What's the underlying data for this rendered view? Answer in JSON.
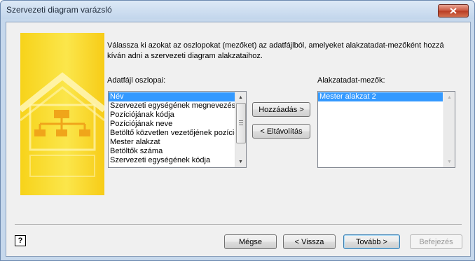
{
  "window": {
    "title": "Szervezeti diagram varázsló"
  },
  "description": "Válassza ki azokat az oszlopokat (mezőket) az adatfájlból, amelyeket alakzatadat-mezőként hozzá kíván adni a szervezeti diagram alakzataihoz.",
  "left_list": {
    "label": "Adatfájl oszlopai:",
    "items": [
      "Név",
      "Szervezeti egységének megnevezése",
      "Pozíciójának kódja",
      "Pozíciójának neve",
      "Betöltő közvetlen vezetőjének pozíciója",
      "Mester alakzat",
      "Betöltők száma",
      "Szervezeti egységének kódja"
    ],
    "selected_index": 0
  },
  "right_list": {
    "label": "Alakzatadat-mezők:",
    "items": [
      "Mester alakzat 2"
    ],
    "selected_index": 0
  },
  "buttons": {
    "add": "Hozzáadás >",
    "remove": "< Eltávolítás",
    "cancel": "Mégse",
    "back": "< Vissza",
    "next": "Tovább >",
    "finish": "Befejezés"
  },
  "help": {
    "glyph": "?"
  },
  "icons": {
    "close": "close-icon",
    "help": "help-icon",
    "scroll_up": "scroll-up-icon",
    "scroll_down": "scroll-down-icon"
  },
  "colors": {
    "selection": "#3399ff",
    "banner": "#f9d72a",
    "close_button": "#c9553d"
  }
}
